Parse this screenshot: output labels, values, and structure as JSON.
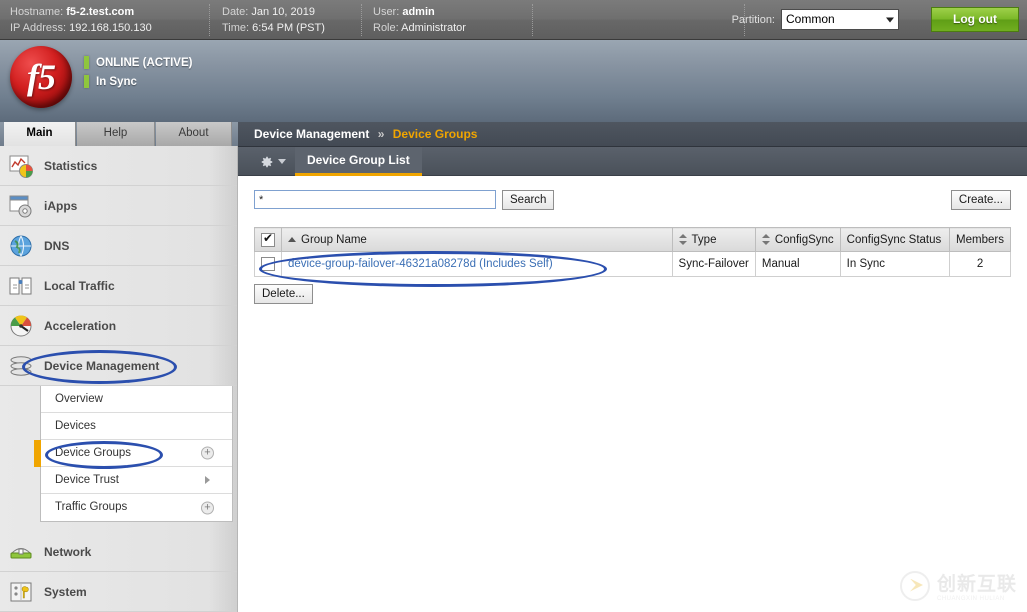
{
  "topbar": {
    "hostname_label": "Hostname:",
    "hostname_value": "f5-2.test.com",
    "ip_label": "IP Address:",
    "ip_value": "192.168.150.130",
    "date_label": "Date:",
    "date_value": "Jan 10, 2019",
    "time_label": "Time:",
    "time_value": "6:54 PM (PST)",
    "user_label": "User:",
    "user_value": "admin",
    "role_label": "Role:",
    "role_value": "Administrator",
    "partition_label": "Partition:",
    "partition_value": "Common",
    "partition_options": [
      "Common"
    ],
    "logout_label": "Log out"
  },
  "banner": {
    "logo_text": "f5",
    "status_primary": "ONLINE (ACTIVE)",
    "status_secondary": "In Sync",
    "status_color": "#8fc63d"
  },
  "nav_tabs": [
    {
      "label": "Main",
      "active": true
    },
    {
      "label": "Help",
      "active": false
    },
    {
      "label": "About",
      "active": false
    }
  ],
  "sidebar": {
    "items": [
      {
        "label": "Statistics",
        "icon": "statistics-icon"
      },
      {
        "label": "iApps",
        "icon": "iapps-icon"
      },
      {
        "label": "DNS",
        "icon": "dns-globe-icon"
      },
      {
        "label": "Local Traffic",
        "icon": "local-traffic-icon"
      },
      {
        "label": "Acceleration",
        "icon": "acceleration-gauge-icon"
      },
      {
        "label": "Device Management",
        "icon": "device-management-icon"
      },
      {
        "label": "Network",
        "icon": "network-icon"
      },
      {
        "label": "System",
        "icon": "system-icon"
      }
    ],
    "submenu": [
      {
        "label": "Overview",
        "selected": false,
        "affordance": "none"
      },
      {
        "label": "Devices",
        "selected": false,
        "affordance": "none"
      },
      {
        "label": "Device Groups",
        "selected": true,
        "affordance": "plus"
      },
      {
        "label": "Device Trust",
        "selected": false,
        "affordance": "arrow"
      },
      {
        "label": "Traffic Groups",
        "selected": false,
        "affordance": "plus"
      }
    ]
  },
  "content": {
    "breadcrumb_root": "Device Management",
    "breadcrumb_sep": "»",
    "breadcrumb_current": "Device Groups",
    "tab_label": "Device Group List",
    "search": {
      "value": "*",
      "placeholder": "",
      "search_button": "Search"
    },
    "create_button": "Create...",
    "delete_button": "Delete...",
    "table": {
      "columns": [
        {
          "label": "Group Name",
          "sort": "asc"
        },
        {
          "label": "Type",
          "sort": "both"
        },
        {
          "label": "ConfigSync",
          "sort": "both"
        },
        {
          "label": "ConfigSync Status",
          "sort": "none"
        },
        {
          "label": "Members",
          "sort": "none"
        }
      ],
      "rows": [
        {
          "name": "device-group-failover-46321a08278d (Includes Self)",
          "type": "Sync-Failover",
          "configsync": "Manual",
          "configsync_status": "In Sync",
          "members": "2"
        }
      ]
    }
  },
  "watermark": {
    "cn": "创新互联",
    "en": "CHUANGXIN HULIAN"
  },
  "annotations": {
    "color": "#2b4fae",
    "targets": [
      "device-management-nav",
      "device-groups-submenu",
      "device-group-row"
    ]
  }
}
